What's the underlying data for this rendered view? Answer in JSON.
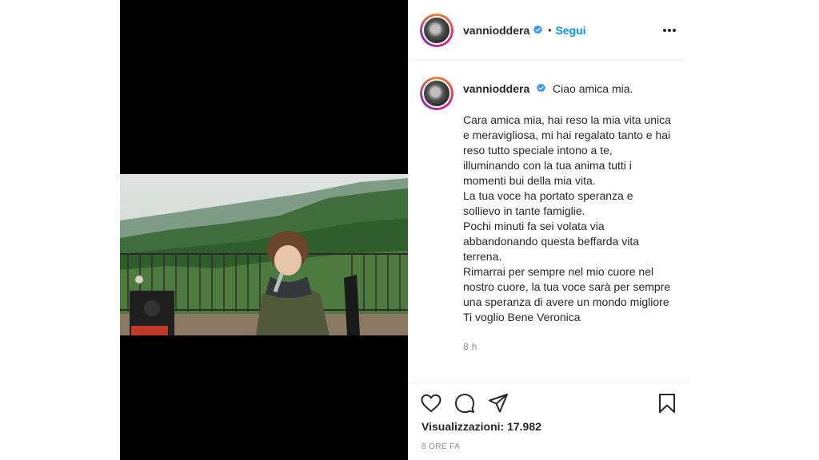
{
  "post": {
    "username": "vannioddera",
    "follow_label": "Segui",
    "dot": "•",
    "caption_title": "Ciao amica mia.",
    "caption_text": "Cara amica mia, hai reso la mia vita unica e meravigliosa, mi hai regalato tanto e hai reso tutto speciale intono a te, illuminando con la tua anima tutti i momenti bui della mia vita.\nLa tua voce ha portato speranza e sollievo in tante famiglie.\nPochi minuti fa sei volata via abbandonando questa beffarda vita terrena.\nRimarrai per sempre nel mio cuore nel nostro cuore, la tua voce sarà per sempre una speranza di avere un mondo migliore\nTi voglio Bene Veronica",
    "time": "8 h",
    "views": "Visualizzazioni: 17.982",
    "date": "8 ORE FA"
  },
  "icons": {
    "verified": "verified-badge-icon",
    "more": "more-options-icon",
    "like": "heart-icon",
    "comment": "comment-icon",
    "share": "send-icon",
    "save": "bookmark-icon"
  },
  "colors": {
    "link": "#0095f6",
    "verified": "#3897f0",
    "text": "#262626",
    "muted": "#8e8e8e"
  }
}
